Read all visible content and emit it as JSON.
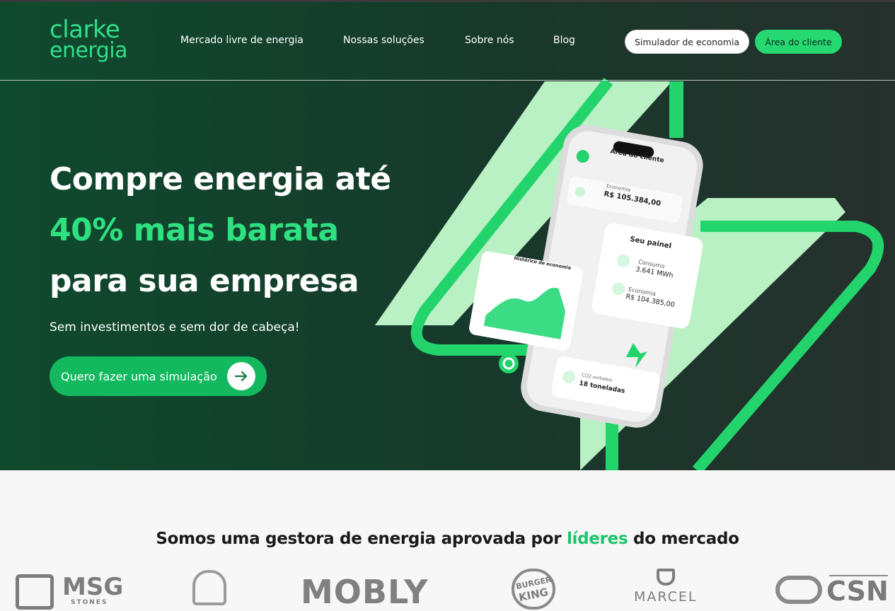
{
  "header": {
    "logo_line1": "clarke",
    "logo_line2": "energia",
    "nav": [
      "Mercado livre de energia",
      "Nossas soluções",
      "Sobre nós",
      "Blog"
    ],
    "simulator_button": "Simulador de economia",
    "client_area_button": "Área do cliente"
  },
  "hero": {
    "title_line1": "Compre energia até",
    "title_line2": "40% mais barata",
    "title_line3": "para sua empresa",
    "subtitle": "Sem investimentos e sem dor de cabeça!",
    "cta_label": "Quero fazer uma simulação"
  },
  "phone": {
    "header_title": "Área do cliente",
    "economy_label": "Economia",
    "economy_value": "R$ 105.384,00",
    "history_title": "Histórico de economia",
    "panel_title": "Seu painel",
    "consumption_label": "Consumo",
    "consumption_value": "3.641 MWh",
    "panel_economy_label": "Economia",
    "panel_economy_value": "R$ 104.385,00",
    "co2_label": "CO2 evitados",
    "co2_value": "18 toneladas"
  },
  "partners": {
    "title_before": "Somos uma gestora de energia aprovada por ",
    "title_highlight": "líderes",
    "title_after": " do mercado",
    "brands": [
      "MSG",
      "STONES",
      "MOBLY",
      "BURGER",
      "KING",
      "MARCEL",
      "CSN"
    ]
  },
  "colors": {
    "accent": "#25d872",
    "dark_green": "#0f4a2e",
    "light_green": "#bff3c8"
  }
}
